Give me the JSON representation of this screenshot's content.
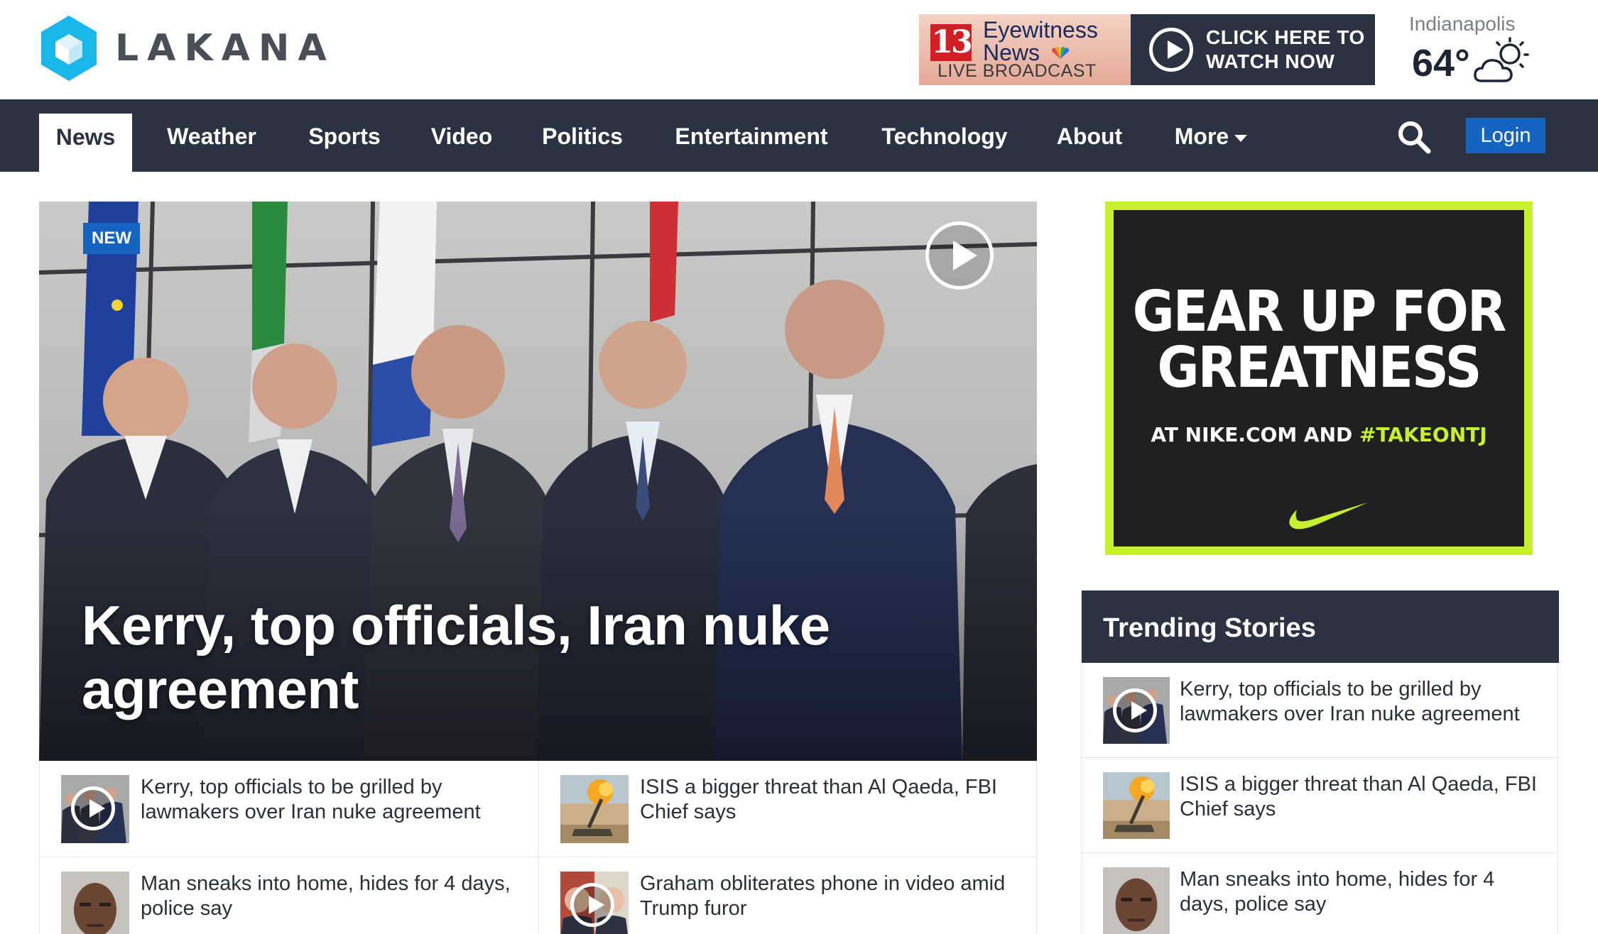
{
  "brand": {
    "name": "LAKANA"
  },
  "ad_banner": {
    "channel_number": "13",
    "line1": "Eyewitness",
    "line2": "News",
    "line3": "LIVE BROADCAST",
    "cta_line1": "CLICK HERE TO",
    "cta_line2": "WATCH NOW"
  },
  "weather": {
    "city": "Indianapolis",
    "temp": "64°",
    "icon": "partly-cloudy-icon"
  },
  "nav": {
    "items": [
      {
        "label": "News",
        "active": true
      },
      {
        "label": "Weather"
      },
      {
        "label": "Sports"
      },
      {
        "label": "Video"
      },
      {
        "label": "Politics"
      },
      {
        "label": "Entertainment"
      },
      {
        "label": "Technology"
      },
      {
        "label": "About"
      },
      {
        "label": "More"
      }
    ],
    "search_icon": "search-icon",
    "login_label": "Login"
  },
  "hero": {
    "badge": "NEW",
    "title": "Kerry, top officials, Iran nuke agreement"
  },
  "stories": [
    {
      "title": "Kerry, top officials to be grilled by lawmakers over Iran nuke agreement",
      "video": true
    },
    {
      "title": "ISIS a bigger threat than Al Qaeda, FBI Chief says",
      "video": false
    },
    {
      "title": "Man sneaks into home, hides for 4 days, police say",
      "video": false
    },
    {
      "title": "Graham obliterates phone in video amid Trump furor",
      "video": true
    }
  ],
  "sidebar_ad": {
    "headline_line1": "GEAR UP FOR",
    "headline_line2": "GREATNESS",
    "sub_prefix": "AT NIKE.COM AND ",
    "sub_hashtag": "#TAKEONTJ",
    "logo": "nike-swoosh"
  },
  "trending": {
    "title": "Trending Stories",
    "items": [
      {
        "title": "Kerry, top officials to be grilled by lawmakers over Iran nuke agreement",
        "video": true
      },
      {
        "title": "ISIS a bigger threat than Al Qaeda, FBI Chief says",
        "video": false
      },
      {
        "title": "Man sneaks into home, hides for 4 days, police say",
        "video": false
      }
    ]
  },
  "colors": {
    "nav_bg": "#2b3342",
    "accent_blue": "#1565c0",
    "logo_cyan": "#19b6ea",
    "nike_green": "#c6f02e"
  }
}
